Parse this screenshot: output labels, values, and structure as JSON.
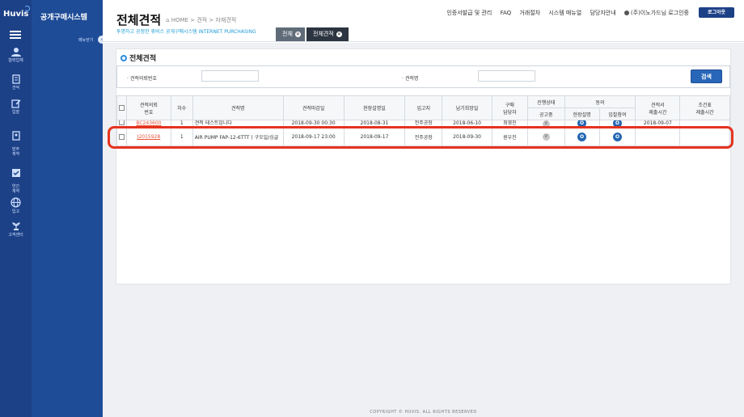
{
  "brand": {
    "logo": "Huvis",
    "system_name": "공개구매시스템",
    "fold_label": "메뉴닫기"
  },
  "rail": [
    {
      "icon": "users-icon",
      "label": "협력업체"
    },
    {
      "icon": "document-icon",
      "label": "견적"
    },
    {
      "icon": "edit-icon",
      "label": "입찰"
    },
    {
      "icon": "contract-icon",
      "label": "발주\n계약"
    },
    {
      "icon": "check-icon",
      "label": "연간\n계약"
    },
    {
      "icon": "globe-icon",
      "label": "입고"
    },
    {
      "icon": "plant-icon",
      "label": "고객센터"
    }
  ],
  "header": {
    "title": "전체견적",
    "breadcrumb": "HOME > 견적 > 자재견적",
    "slogan": "투명하고 공정한 휴비스 공개구매시스템  INTERNET PURCHASING",
    "links": [
      "인증서발급 및 관리",
      "FAQ",
      "거래절차",
      "시스템 매뉴얼",
      "담당자안내"
    ],
    "user": "(주)이노가드님 로그인중",
    "logout": "로그아웃",
    "tabs": [
      {
        "label": "전체"
      },
      {
        "label": "전체견적"
      }
    ]
  },
  "panel": {
    "title": "전체견적",
    "search": {
      "label1": "견적의뢰번호",
      "label2": "견적명",
      "value1": "",
      "value2": "",
      "button": "검색"
    }
  },
  "table": {
    "headers": {
      "no": "견적의뢰\n번호",
      "rev": "차수",
      "name": "견적명",
      "deadline": "견적마감일",
      "site_date": "현장설명일",
      "plant": "입고지",
      "delivery": "납기희망일",
      "buyer": "구매\n담당자",
      "status": "진행상태",
      "status_sub": "공고중",
      "agree": "동의",
      "agree_site": "현장설명",
      "agree_bid": "입찰참여",
      "submit": "견적서\n제출시간",
      "cond": "조건표\n제출시간"
    },
    "rows": [
      {
        "no": "BC243600",
        "rev": "1",
        "name": "견적 테스트입니다",
        "deadline": "2018-09-30 00:30",
        "site_date": "2018-08-31",
        "plant": "전주공장",
        "delivery": "2018-06-10",
        "buyer": "최영진",
        "status": "V",
        "agree_site": "O",
        "agree_bid": "O",
        "submit": "2018-09-07",
        "cond": ""
      },
      {
        "no": "J2015928",
        "rev": "1",
        "name": "AIR PUMP  FAP-12-6TTT ( 구오일/싱글",
        "deadline": "2018-09-17 23:00",
        "site_date": "2018-09-17",
        "plant": "전주공장",
        "delivery": "2018-09-30",
        "buyer": "원우진",
        "status": "V",
        "agree_site": "O",
        "agree_bid": "O",
        "submit": "",
        "cond": ""
      }
    ]
  },
  "footer": "COPYRIGHT © HUVIS. ALL RIGHTS RESERVED"
}
